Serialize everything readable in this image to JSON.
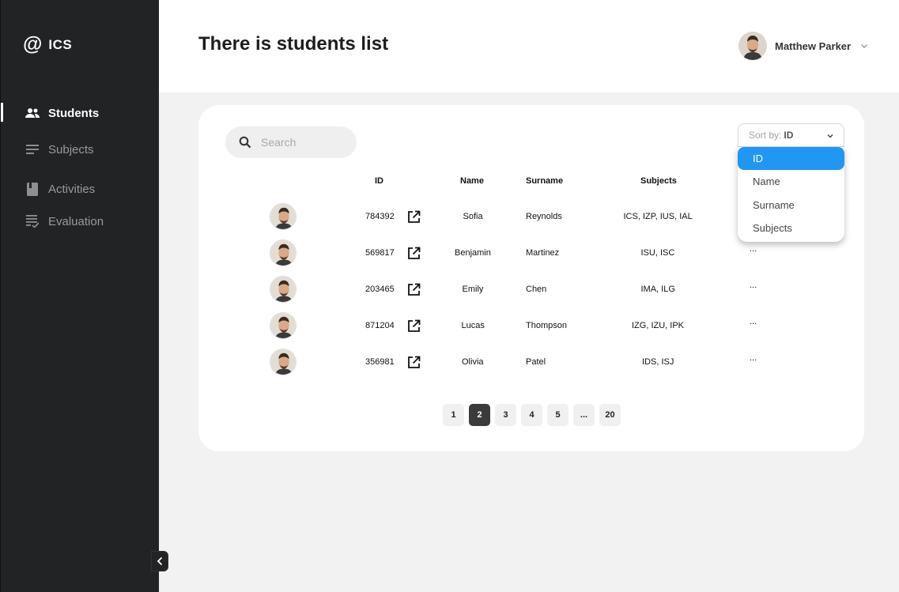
{
  "app": {
    "logo_symbol": "@",
    "logo_text": "ICS"
  },
  "sidebar": {
    "items": [
      {
        "label": "Students",
        "icon": "people-icon",
        "active": true
      },
      {
        "label": "Subjects",
        "icon": "lines-icon",
        "active": false
      },
      {
        "label": "Activities",
        "icon": "book-icon",
        "active": false
      },
      {
        "label": "Evaluation",
        "icon": "checklist-icon",
        "active": false
      }
    ]
  },
  "header": {
    "title": "There is students list",
    "user_name": "Matthew Parker"
  },
  "search": {
    "placeholder": "Search"
  },
  "table": {
    "columns": [
      "ID",
      "Name",
      "Surname",
      "Subjects"
    ],
    "rows": [
      {
        "id": "784392",
        "name": "Sofia",
        "surname": "Reynolds",
        "subjects": "ICS, IZP, IUS, IAL",
        "more": "..."
      },
      {
        "id": "569817",
        "name": "Benjamin",
        "surname": "Martinez",
        "subjects": "ISU, ISC",
        "more": "..."
      },
      {
        "id": "203465",
        "name": "Emily",
        "surname": "Chen",
        "subjects": "IMA, ILG",
        "more": "..."
      },
      {
        "id": "871204",
        "name": "Lucas",
        "surname": "Thompson",
        "subjects": "IZG, IZU, IPK",
        "more": "..."
      },
      {
        "id": "356981",
        "name": "Olivia",
        "surname": "Patel",
        "subjects": "IDS, ISJ",
        "more": "..."
      }
    ]
  },
  "pagination": {
    "pages": [
      "1",
      "2",
      "3",
      "4",
      "5",
      "...",
      "20"
    ],
    "current": "2"
  },
  "sort": {
    "label": "Sort by:",
    "value": "ID",
    "options": [
      "ID",
      "Name",
      "Surname",
      "Subjects"
    ],
    "selected": "ID"
  },
  "colors": {
    "sidebar": "#222325",
    "accent": "#2196f3",
    "active_page": "#3b3b3b"
  }
}
